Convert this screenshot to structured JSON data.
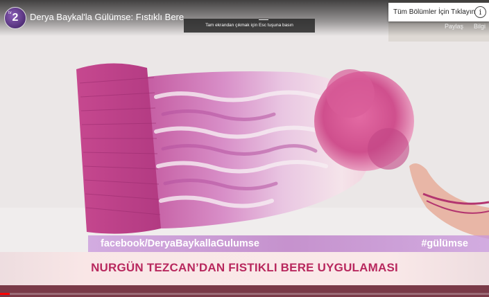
{
  "video": {
    "title": "Derya Baykal'la Gülümse: Fıstıklı Bere",
    "channel_logo_text": "2",
    "channel_logo_small": "tv",
    "share_label": "Paylaş",
    "info_label": "Bilgi",
    "esc_toast": "Tam ekrandan çıkmak için  Esc  tuşuna basın",
    "chapters_label": "Tüm Bölümler İçin Tıklayın",
    "info_icon_glyph": "i",
    "progress": 0.02
  },
  "overlay": {
    "facebook": "facebook/DeryaBaykallaGulumse",
    "hashtag": "#gülümse",
    "headline": "NURGÜN TEZCAN’DAN FISTIKLI BERE UYGULAMASI"
  },
  "colors": {
    "accent": "#b8285e",
    "progress": "#ff0000"
  },
  "icons": [
    "channel-logo",
    "info-icon",
    "fullscreen-icon"
  ]
}
